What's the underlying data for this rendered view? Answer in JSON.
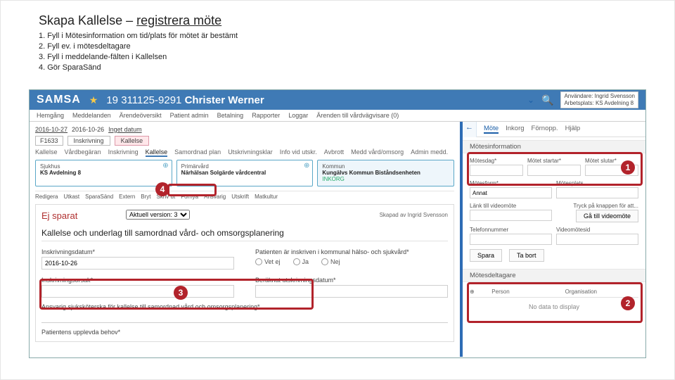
{
  "slide": {
    "title_a": "Skapa Kallelse – ",
    "title_b": "registrera möte",
    "steps": [
      "1. Fyll i Mötesinformation om tid/plats för mötet är bestämt",
      "2. Fyll ev. i mötesdeltagare",
      "3. Fyll i meddelande-fälten i Kallelsen",
      "4. Gör SparaSänd"
    ]
  },
  "header": {
    "logo": "SAMSA",
    "patient_id": "19 311125-9291",
    "patient_name": "Christer Werner",
    "login_user_label": "Användare:",
    "login_user": "Ingrid Svensson",
    "login_place_label": "Arbetsplats:",
    "login_place": "KS Avdelning 8"
  },
  "menubar": [
    "Hemgång",
    "Meddelanden",
    "Ärendeöversikt",
    "Patient admin",
    "Betalning",
    "Rapporter",
    "Loggar",
    "Ärenden till vårdvägvisare (0)"
  ],
  "daterow": {
    "today": "2016-10-27",
    "yesterday": "2016-10-26",
    "tag": "Inget datum",
    "btn1": "F1633",
    "tab_ins": "Inskrivning",
    "tab_kal": "Kallelse"
  },
  "subtabs": [
    "Kallelse",
    "Vårdbegäran",
    "Inskrivning",
    "Kallelse",
    "Samordnad plan",
    "Utskrivningsklar",
    "Info vid utskr.",
    "Avbrott",
    "Medd vård/omsorg",
    "Admin medd."
  ],
  "cards": {
    "c1_t": "Sjukhus",
    "c1_v": "KS Avdelning 8",
    "c2_t": "Primärvård",
    "c2_v": "Närhälsan Solgärde vårdcentral",
    "c3_t": "Kommun",
    "c3_v": "Kungälvs Kommun Biståndsenheten",
    "c3_s": "INKORG"
  },
  "filters": [
    "Redigera",
    "Utkast",
    "SparaSänd",
    "Extern",
    "Bryt",
    "Skriv ut",
    "Förnya",
    "Ansvarig",
    "Utskrift",
    "Matkultur"
  ],
  "panel": {
    "ej": "Ej sparat",
    "ver_label": "Aktuell version: 3",
    "sig": "Skapad av Ingrid Svensson",
    "title": "Kallelse och underlag till samordnad vård- och omsorgsplanering",
    "f1": "Inskrivningsdatum*",
    "f1v": "2016-10-26",
    "f2": "Patienten är inskriven i kommunal hälso- och sjukvård*",
    "r": [
      "Vet ej",
      "Ja",
      "Nej"
    ],
    "f3": "Inskrivningsorsak*",
    "f4": "Beräknat utskrivningsdatum*",
    "f5": "Ansvarig sjuksköterska för kallelse till samordnad vård och omsorgsplanering*",
    "f6": "Patientens upplevda behov*"
  },
  "side": {
    "tabs": [
      "Möte",
      "Inkorg",
      "Förnopp.",
      "Hjälp"
    ],
    "sec1": "Mötesinformation",
    "md": "Mötesdag*",
    "ms": "Mötet startar*",
    "mc": "Mötet slutar*",
    "mf": "Mötesform*",
    "mp": "Mötesplats",
    "mf_v": "Annat",
    "lk": "Länk till videomöte",
    "lk_hint": "Tryck på knappen för att...",
    "btn_vid": "Gå till videomöte",
    "tn": "Telefonnummer",
    "vid": "Videomötesid",
    "save": "Spara",
    "cancel": "Ta bort",
    "sec2": "Mötesdeltagare",
    "th": [
      "",
      "Person",
      "Organisation"
    ],
    "nodata": "No data to display"
  },
  "numbers": {
    "n1": "1",
    "n2": "2",
    "n3": "3",
    "n4": "4"
  }
}
